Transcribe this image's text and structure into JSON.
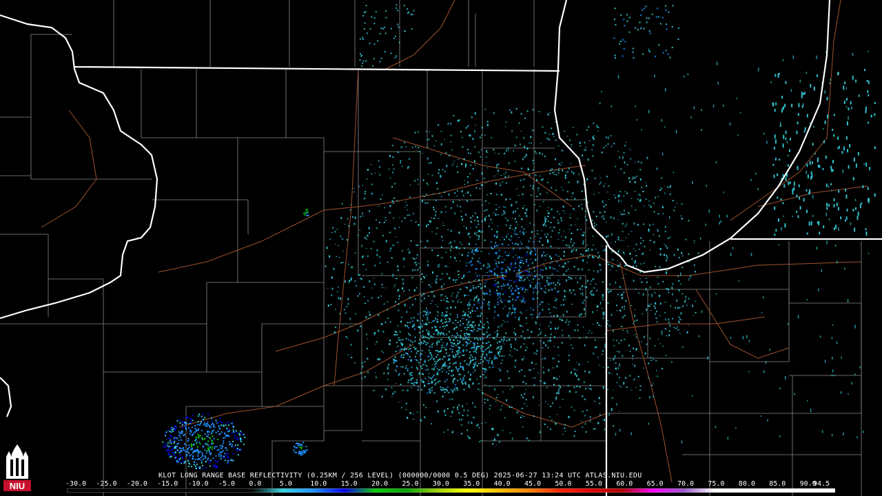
{
  "caption": {
    "product": "KLOT LONG RANGE BASE REFLECTIVITY (0.25KM / 256 LEVEL) (000000/0000 0.5 DEG) 2025-06-27 13:24 UTC  ATLAS.NIU.EDU"
  },
  "colorbar": {
    "ticks": [
      "-30.0",
      "-25.0",
      "-20.0",
      "-15.0",
      "-10.0",
      "-5.0",
      "0.0",
      "5.0",
      "10.0",
      "15.0",
      "20.0",
      "25.0",
      "30.0",
      "35.0",
      "40.0",
      "45.0",
      "50.0",
      "55.0",
      "60.0",
      "65.0",
      "70.0",
      "75.0",
      "80.0",
      "85.0",
      "90.0",
      "94.5"
    ],
    "range": [
      -30.0,
      94.5
    ],
    "stops": [
      {
        "value": -30.0,
        "color": "#000000"
      },
      {
        "value": 0.0,
        "color": "#000000"
      },
      {
        "value": 5.0,
        "color": "#35d3e0"
      },
      {
        "value": 10.0,
        "color": "#1e90ff"
      },
      {
        "value": 15.0,
        "color": "#0000e8"
      },
      {
        "value": 20.0,
        "color": "#00c800"
      },
      {
        "value": 25.0,
        "color": "#00a000"
      },
      {
        "value": 30.0,
        "color": "#9bd000"
      },
      {
        "value": 35.0,
        "color": "#ffff00"
      },
      {
        "value": 40.0,
        "color": "#ffc000"
      },
      {
        "value": 45.0,
        "color": "#ff8000"
      },
      {
        "value": 50.0,
        "color": "#ff2000"
      },
      {
        "value": 55.0,
        "color": "#e00000"
      },
      {
        "value": 60.0,
        "color": "#b00000"
      },
      {
        "value": 65.0,
        "color": "#ff00ff"
      },
      {
        "value": 70.0,
        "color": "#9955c9"
      },
      {
        "value": 75.0,
        "color": "#ffffff"
      },
      {
        "value": 94.5,
        "color": "#ffffff"
      }
    ]
  },
  "logo": {
    "text": "NIU",
    "color": "#c8102e"
  },
  "map": {
    "background": "#000000",
    "state_border_color": "#ffffff",
    "county_border_color": "#8a8a8a",
    "road_color": "#a0522d",
    "echo_colors": [
      "#35d3e0",
      "#1e90ff",
      "#0000e8",
      "#00c800"
    ]
  }
}
